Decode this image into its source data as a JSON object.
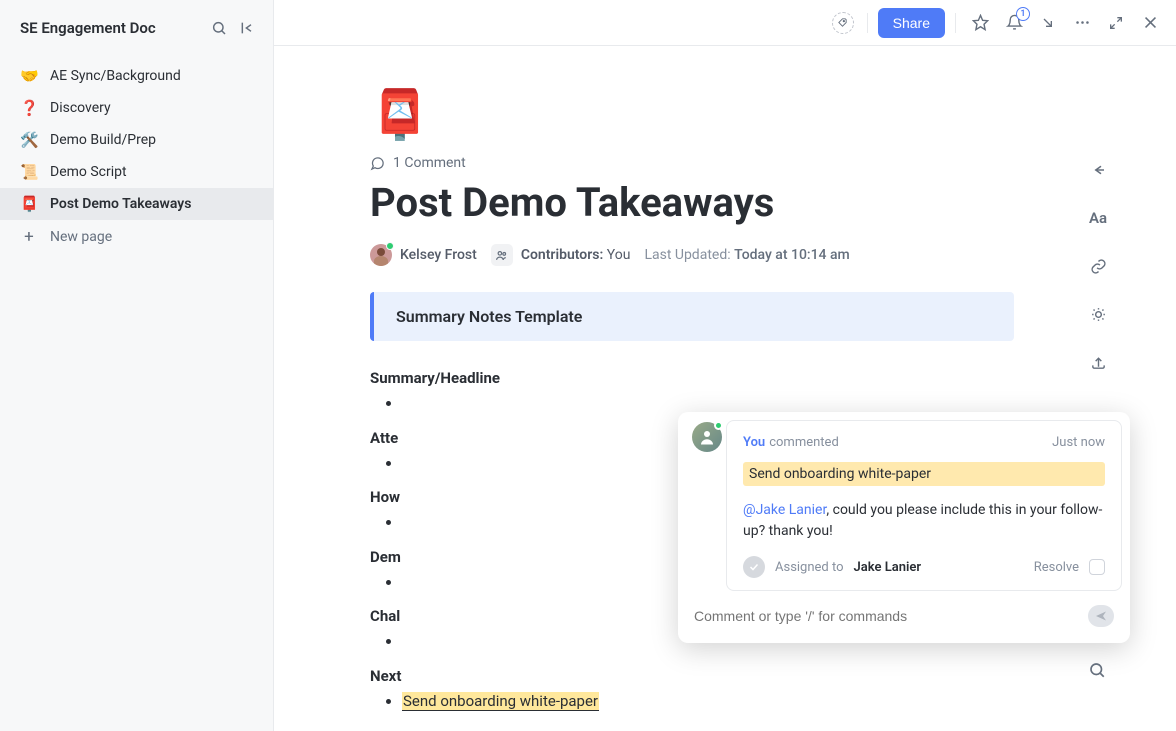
{
  "sidebar": {
    "title": "SE Engagement Doc",
    "items": [
      {
        "emoji": "🤝",
        "label": "AE Sync/Background"
      },
      {
        "emoji": "❓",
        "label": "Discovery"
      },
      {
        "emoji": "🛠️",
        "label": "Demo Build/Prep"
      },
      {
        "emoji": "📜",
        "label": "Demo Script"
      },
      {
        "emoji": "📮",
        "label": "Post Demo Takeaways"
      }
    ],
    "new_page_label": "New page"
  },
  "topbar": {
    "share_label": "Share",
    "notification_count": "1"
  },
  "doc": {
    "emoji": "📮",
    "comment_count_label": "1 Comment",
    "title": "Post Demo Takeaways",
    "owner_name": "Kelsey Frost",
    "contributors_label": "Contributors:",
    "contributors_value": "You",
    "last_updated_label": "Last Updated:",
    "last_updated_value": "Today at 10:14 am",
    "callout": "Summary Notes Template",
    "sections": [
      "Summary/Headline",
      "Atte",
      "How",
      "Dem",
      "Chal",
      "Next"
    ],
    "next_item": "Send onboarding white-paper"
  },
  "comment": {
    "author": "You",
    "verb": "commented",
    "time": "Just now",
    "highlight": "Send onboarding white-paper",
    "mention": "@Jake Lanier",
    "body_rest": ", could you please include this in your follow-up? thank you!",
    "assigned_label": "Assigned to",
    "assignee": "Jake Lanier",
    "resolve_label": "Resolve",
    "input_placeholder": "Comment or type '/' for commands"
  },
  "right_rail": {
    "aa_label": "Aa"
  }
}
